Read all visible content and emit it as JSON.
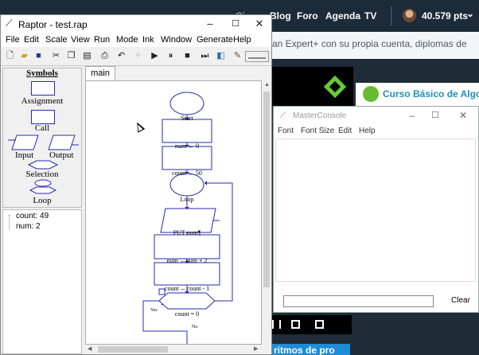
{
  "website": {
    "nav": [
      "Blog",
      "Foro",
      "Agenda",
      "TV"
    ],
    "nav_partial": "Ci",
    "points": "40.579 pts",
    "points_caret": "⌄",
    "banner_text": "an Expert+ con su propia cuenta, diplomas de",
    "course_title": "Curso Básico de Algori",
    "bottom_button": "ritmos de pro"
  },
  "raptor": {
    "title": "Raptor - test.rap",
    "window_buttons": {
      "minimize": "–",
      "maximize": "☐",
      "close": "✕"
    },
    "menu": [
      "File",
      "Edit",
      "Scale",
      "View",
      "Run",
      "Mode",
      "Ink",
      "Window",
      "Generate",
      "Help"
    ],
    "symbols_title": "Symbols",
    "symbols": [
      "Assignment",
      "Call",
      "Input",
      "Output",
      "Selection",
      "Loop"
    ],
    "watch": [
      "count: 49",
      "num: 2"
    ],
    "tab": "main",
    "flowchart": {
      "start": "Start",
      "assign_num": "num ← 0",
      "assign_count": "count ← 50",
      "loop": "Loop",
      "output": "PUT num¶",
      "assign_num2": "num ←num + 2",
      "assign_count2": "count ←count - 1",
      "condition": "count = 0",
      "yes": "Yes",
      "no": "No",
      "collapse": "−"
    }
  },
  "console": {
    "title": "MasterConsole",
    "window_buttons": {
      "minimize": "–",
      "maximize": "☐",
      "close": "✕"
    },
    "menu": [
      "Font",
      "Font Size",
      "Edit",
      "Help"
    ],
    "input_value": "",
    "clear_label": "Clear"
  }
}
